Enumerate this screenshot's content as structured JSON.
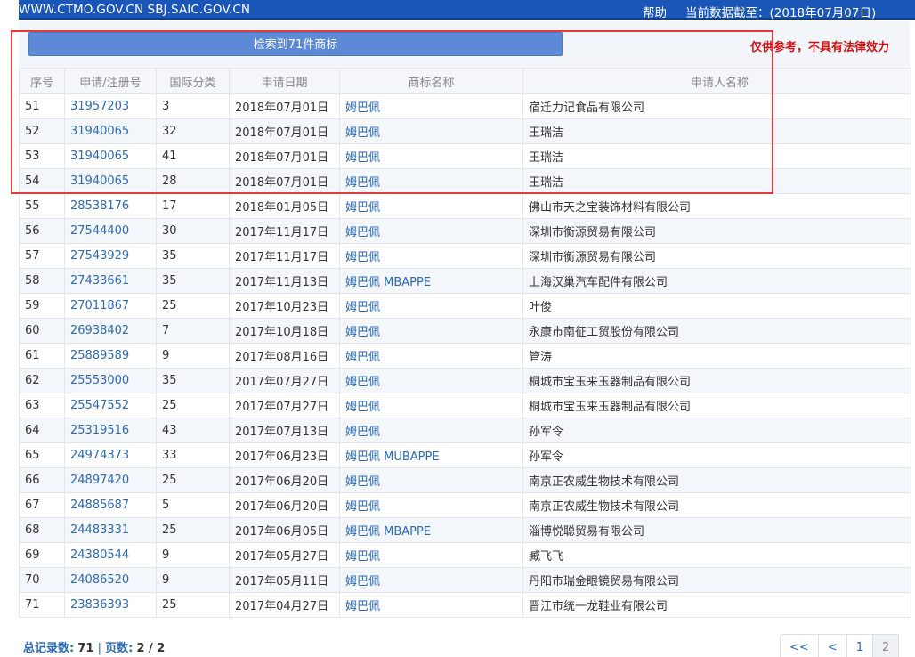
{
  "header": {
    "site": "WWW.CTMO.GOV.CN SBJ.SAIC.GOV.CN",
    "help": "帮助",
    "date": "当前数据截至：(2018年07月07日)"
  },
  "search": {
    "result_label": "检索到71件商标",
    "disclaimer": "仅供参考，不具有法律效力"
  },
  "table": {
    "headers": [
      "序号",
      "申请/注册号",
      "国际分类",
      "申请日期",
      "商标名称",
      "申请人名称"
    ],
    "rows": [
      [
        "51",
        "31957203",
        "3",
        "2018年07月01日",
        "姆巴佩",
        "宿迁力记食品有限公司"
      ],
      [
        "52",
        "31940065",
        "32",
        "2018年07月01日",
        "姆巴佩",
        "王瑞洁"
      ],
      [
        "53",
        "31940065",
        "41",
        "2018年07月01日",
        "姆巴佩",
        "王瑞洁"
      ],
      [
        "54",
        "31940065",
        "28",
        "2018年07月01日",
        "姆巴佩",
        "王瑞洁"
      ],
      [
        "55",
        "28538176",
        "17",
        "2018年01月05日",
        "姆巴佩",
        "佛山市天之宝装饰材料有限公司"
      ],
      [
        "56",
        "27544400",
        "30",
        "2017年11月17日",
        "姆巴佩",
        "深圳市衡源贸易有限公司"
      ],
      [
        "57",
        "27543929",
        "35",
        "2017年11月17日",
        "姆巴佩",
        "深圳市衡源贸易有限公司"
      ],
      [
        "58",
        "27433661",
        "35",
        "2017年11月13日",
        "姆巴佩 MBAPPE",
        "上海汉巢汽车配件有限公司"
      ],
      [
        "59",
        "27011867",
        "25",
        "2017年10月23日",
        "姆巴佩",
        "叶俊"
      ],
      [
        "60",
        "26938402",
        "7",
        "2017年10月18日",
        "姆巴佩",
        "永康市南征工贸股份有限公司"
      ],
      [
        "61",
        "25889589",
        "9",
        "2017年08月16日",
        "姆巴佩",
        "管涛"
      ],
      [
        "62",
        "25553000",
        "35",
        "2017年07月27日",
        "姆巴佩",
        "桐城市宝玉来玉器制品有限公司"
      ],
      [
        "63",
        "25547552",
        "25",
        "2017年07月27日",
        "姆巴佩",
        "桐城市宝玉来玉器制品有限公司"
      ],
      [
        "64",
        "25319516",
        "43",
        "2017年07月13日",
        "姆巴佩",
        "孙军令"
      ],
      [
        "65",
        "24974373",
        "33",
        "2017年06月23日",
        "姆巴佩 MUBAPPE",
        "孙军令"
      ],
      [
        "66",
        "24897420",
        "25",
        "2017年06月20日",
        "姆巴佩",
        "南京正农威生物技术有限公司"
      ],
      [
        "67",
        "24885687",
        "5",
        "2017年06月20日",
        "姆巴佩",
        "南京正农威生物技术有限公司"
      ],
      [
        "68",
        "24483331",
        "25",
        "2017年06月05日",
        "姆巴佩 MBAPPE",
        "淄博悦聪贸易有限公司"
      ],
      [
        "69",
        "24380544",
        "9",
        "2017年05月27日",
        "姆巴佩",
        "臧飞飞"
      ],
      [
        "70",
        "24086520",
        "9",
        "2017年05月11日",
        "姆巴佩",
        "丹阳市瑞金眼镜贸易有限公司"
      ],
      [
        "71",
        "23836393",
        "25",
        "2017年04月27日",
        "姆巴佩",
        "晋江市统一龙鞋业有限公司"
      ]
    ]
  },
  "footer": {
    "total_label": "总记录数:",
    "total_value": "71",
    "separator": "|",
    "pages_label": "页数:",
    "pages_value": "2 / 2"
  },
  "pager": {
    "first": "<<",
    "prev": "<",
    "page1": "1",
    "page2": "2"
  },
  "colors": {
    "header_bar": "#1a56b8",
    "button": "#5c8ad6",
    "link": "#2a6ab8",
    "disclaimer": "#d01010",
    "highlight": "#e23b3b"
  }
}
